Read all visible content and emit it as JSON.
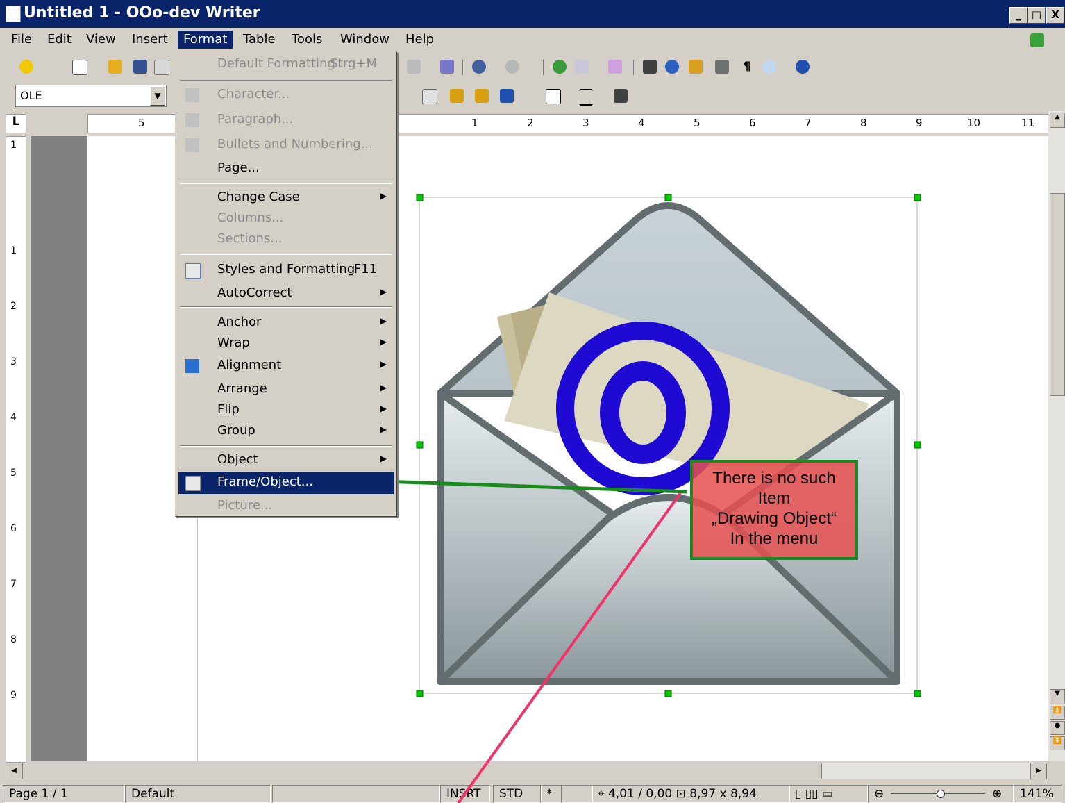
{
  "window": {
    "title": "Untitled 1 - OOo-dev Writer",
    "minimize": "_",
    "restore": "□",
    "close": "X"
  },
  "menubar": [
    "File",
    "Edit",
    "View",
    "Insert",
    "Format",
    "Table",
    "Tools",
    "Window",
    "Help"
  ],
  "toolbar2": {
    "style_box": "OLE"
  },
  "ruler_h": [
    "5",
    "1",
    "2",
    "3",
    "4",
    "5",
    "6",
    "7",
    "8",
    "9",
    "10",
    "11"
  ],
  "ruler_v": [
    "1",
    "1",
    "2",
    "3",
    "4",
    "5",
    "6",
    "7",
    "8",
    "9"
  ],
  "format_menu": {
    "items": [
      {
        "label": "Default Formatting",
        "shortcut": "Strg+M",
        "disabled": true
      },
      {
        "label": "Character...",
        "disabled": true
      },
      {
        "label": "Paragraph...",
        "disabled": true
      },
      {
        "label": "Bullets and Numbering...",
        "disabled": true
      },
      {
        "label": "Page..."
      },
      {
        "label": "Change Case",
        "submenu": true
      },
      {
        "label": "Columns...",
        "disabled": true
      },
      {
        "label": "Sections...",
        "disabled": true
      },
      {
        "label": "Styles and Formatting",
        "shortcut": "F11"
      },
      {
        "label": "AutoCorrect",
        "submenu": true
      },
      {
        "label": "Anchor",
        "submenu": true
      },
      {
        "label": "Wrap",
        "submenu": true
      },
      {
        "label": "Alignment",
        "submenu": true
      },
      {
        "label": "Arrange",
        "submenu": true
      },
      {
        "label": "Flip",
        "submenu": true
      },
      {
        "label": "Group",
        "submenu": true
      },
      {
        "label": "Object",
        "submenu": true
      },
      {
        "label": "Frame/Object...",
        "selected": true
      },
      {
        "label": "Picture...",
        "disabled": true
      }
    ]
  },
  "annotation": {
    "lines": [
      "There is no such",
      "Item",
      "„Drawing Object“",
      "In the menu"
    ]
  },
  "statusbar": {
    "page": "Page 1 / 1",
    "style": "Default",
    "insert_mode": "INSRT",
    "selection_mode": "STD",
    "modified": "*",
    "position": "4,01 / 0,00",
    "size": "8,97 x 8,94",
    "zoom": "141%"
  },
  "colors": {
    "title_bar": "#0a246a",
    "menu_highlight": "#0a246a",
    "note_fill": "#e65050",
    "note_border": "#1a8a20",
    "at_sign": "#1e0ad2",
    "selection_handle": "#00c800",
    "arrow_line": "#f0336a"
  }
}
